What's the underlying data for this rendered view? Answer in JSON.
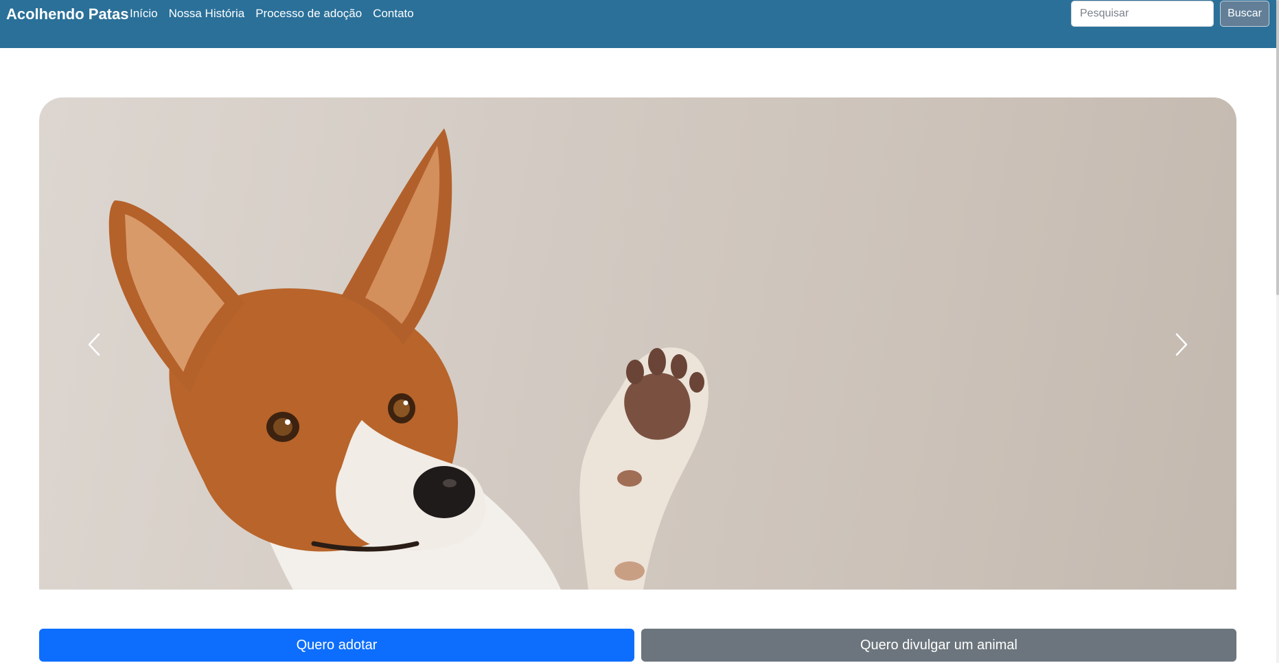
{
  "navbar": {
    "brand": "Acolhendo Patas",
    "links": [
      "Início",
      "Nossa História",
      "Processo de adoção",
      "Contato"
    ],
    "background": "#2a7099"
  },
  "search": {
    "placeholder": "Pesquisar",
    "value": "",
    "button_label": "Buscar"
  },
  "carousel": {
    "image_alt": "Cachorro acenando com a pata",
    "prev_icon": "chevron-left-icon",
    "next_icon": "chevron-right-icon"
  },
  "actions": {
    "adopt_label": "Quero adotar",
    "publish_label": "Quero divulgar um animal",
    "adopt_color": "#0d6efd",
    "publish_color": "#6c757d"
  }
}
